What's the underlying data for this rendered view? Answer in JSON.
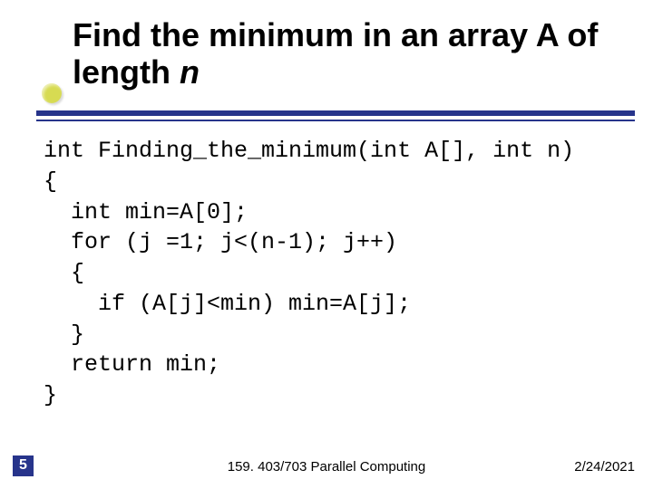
{
  "title": {
    "line1_prefix": "Find the minimum in an array A of",
    "line2_prefix": "length ",
    "line2_ital": "n"
  },
  "code": {
    "l1": "int Finding_the_minimum(int A[], int n)",
    "l2": "{",
    "l3": "  int min=A[0];",
    "l4": "  for (j =1; j<(n-1); j++)",
    "l5": "  {",
    "l6": "    if (A[j]<min) min=A[j];",
    "l7": "  }",
    "l8": "  return min;",
    "l9": "}"
  },
  "footer": {
    "slide_number": "5",
    "course": "159. 403/703 Parallel Computing",
    "date": "2/24/2021"
  }
}
